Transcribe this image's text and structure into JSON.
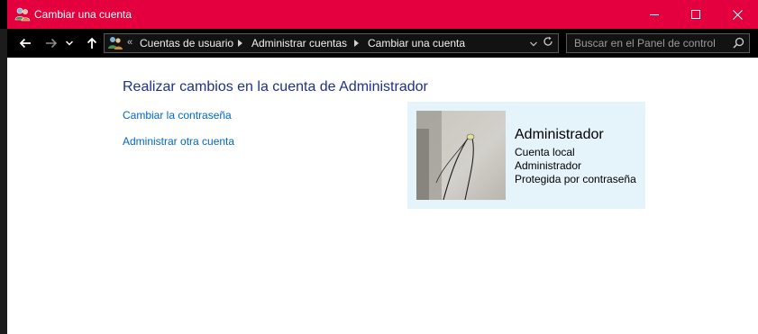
{
  "window": {
    "title": "Cambiar una cuenta",
    "title_bar_color": "#e4003e"
  },
  "navigation": {
    "back_icon": "arrow-left-icon",
    "forward_icon": "arrow-right-icon",
    "recent_icon": "chevron-down-icon",
    "up_icon": "arrow-up-icon"
  },
  "address_bar": {
    "overflow_marker": "«",
    "breadcrumbs": [
      "Cuentas de usuario",
      "Administrar cuentas",
      "Cambiar una cuenta"
    ]
  },
  "search": {
    "placeholder": "Buscar en el Panel de control"
  },
  "main": {
    "heading": "Realizar cambios en la cuenta de Administrador",
    "links": [
      "Cambiar la contraseña",
      "Administrar otra cuenta"
    ]
  },
  "account": {
    "name": "Administrador",
    "details": [
      "Cuenta local",
      "Administrador",
      "Protegida por contraseña"
    ],
    "card_color": "#e5f3fb"
  }
}
